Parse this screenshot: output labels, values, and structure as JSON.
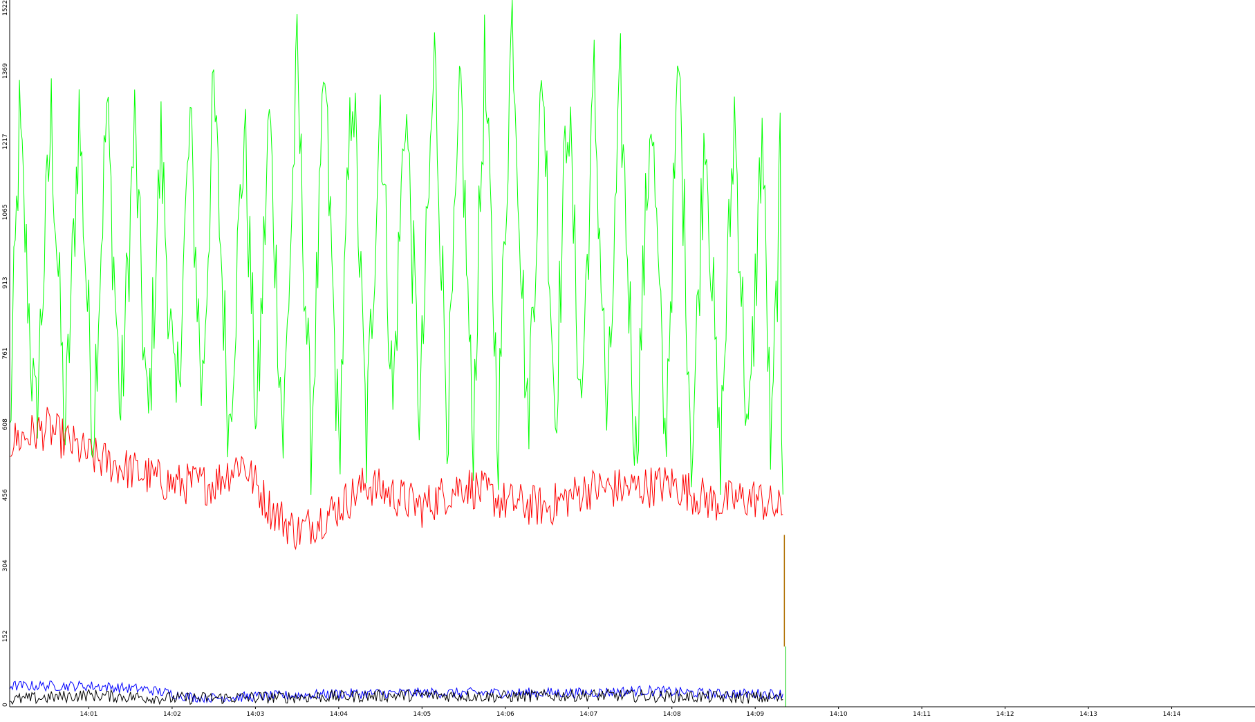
{
  "chart_data": {
    "type": "line",
    "title": "",
    "xlabel": "",
    "ylabel": "",
    "ylim": [
      0,
      1522
    ],
    "yticks": [
      "0",
      "152",
      "304",
      "456",
      "608",
      "761",
      "913",
      "1065",
      "1217",
      "1369",
      "1522"
    ],
    "x_ticks": [
      "14:01",
      "14:02",
      "14:03",
      "14:04",
      "14:05",
      "14:06",
      "14:07",
      "14:08",
      "14:09",
      "14:10",
      "14:11",
      "14:12",
      "14:13",
      "14:14"
    ],
    "x_range": [
      "14:00:03",
      "14:15:00"
    ],
    "data_end": "14:09:20",
    "sample_interval_seconds": 1,
    "grid": false,
    "legend": "none",
    "series": [
      {
        "color": "#00ff00",
        "min": 456,
        "max": 1522,
        "mean": 920,
        "cycle_seconds": 19.5,
        "peak_times": [
          "14:00:10",
          "14:00:33",
          "14:00:53",
          "14:01:13",
          "14:01:33",
          "14:01:52",
          "14:02:13",
          "14:02:30",
          "14:02:52",
          "14:03:10",
          "14:03:30",
          "14:03:50",
          "14:04:10",
          "14:04:30",
          "14:04:48",
          "14:05:09",
          "14:05:28",
          "14:05:45",
          "14:06:05",
          "14:06:27",
          "14:06:45",
          "14:07:04",
          "14:07:23",
          "14:07:45",
          "14:08:05",
          "14:08:24",
          "14:08:45",
          "14:09:05",
          "14:09:18"
        ],
        "peak_values": [
          1250,
          1270,
          1280,
          1290,
          1250,
          1210,
          1250,
          1320,
          1250,
          1280,
          1380,
          1350,
          1380,
          1320,
          1320,
          1400,
          1330,
          1380,
          1522,
          1380,
          1330,
          1340,
          1330,
          1310,
          1380,
          1290,
          1280,
          1250,
          1150
        ],
        "trough_values": [
          570,
          590,
          580,
          600,
          620,
          580,
          600,
          660,
          600,
          590,
          570,
          560,
          540,
          560,
          640,
          620,
          610,
          560,
          590,
          600,
          620,
          630,
          580,
          540,
          560,
          530,
          510,
          540,
          510
        ]
      },
      {
        "color": "#ff0000",
        "min": 340,
        "max": 670,
        "mean": 440,
        "time_points": [
          "14:00:03",
          "14:00:30",
          "14:01:00",
          "14:01:30",
          "14:02:00",
          "14:02:30",
          "14:02:50",
          "14:03:10",
          "14:03:30",
          "14:04:00",
          "14:04:20",
          "14:05:00",
          "14:05:30",
          "14:06:00",
          "14:06:30",
          "14:07:00",
          "14:07:30",
          "14:08:00",
          "14:08:30",
          "14:09:00",
          "14:09:20"
        ],
        "values": [
          570,
          600,
          540,
          510,
          480,
          480,
          530,
          430,
          375,
          430,
          480,
          430,
          480,
          440,
          430,
          470,
          470,
          480,
          440,
          450,
          420
        ]
      },
      {
        "color": "#0000ff",
        "min": 10,
        "max": 60,
        "mean": 28,
        "time_points": [
          "14:00:03",
          "14:01:00",
          "14:01:40",
          "14:02:20",
          "14:03:00",
          "14:04:00",
          "14:05:00",
          "14:06:00",
          "14:07:00",
          "14:07:40",
          "14:08:30",
          "14:09:20"
        ],
        "values": [
          45,
          45,
          38,
          18,
          22,
          28,
          30,
          30,
          30,
          35,
          28,
          28
        ]
      },
      {
        "color": "#000000",
        "min": 0,
        "max": 60,
        "mean": 20,
        "time_points": [
          "14:00:03",
          "14:01:00",
          "14:02:00",
          "14:03:00",
          "14:04:00",
          "14:05:00",
          "14:06:00",
          "14:07:00",
          "14:08:00",
          "14:09:00",
          "14:09:20"
        ],
        "values": [
          15,
          25,
          18,
          20,
          22,
          25,
          22,
          25,
          22,
          20,
          18
        ]
      }
    ],
    "end_spike": {
      "time": "14:09:21",
      "color": "#b07000",
      "from": 130,
      "to": 370
    }
  }
}
